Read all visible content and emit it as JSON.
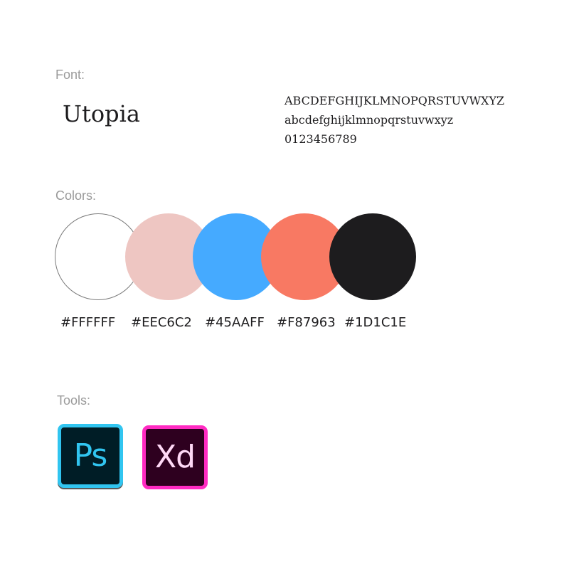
{
  "font_section": {
    "label": "Font:",
    "font_name": "Utopia",
    "uppercase": "ABCDEFGHIJKLMNOPQRSTUVWXYZ",
    "lowercase": "abcdefghijklmnopqrstuvwxyz",
    "digits": "0123456789"
  },
  "colors_section": {
    "label": "Colors:",
    "swatches": [
      {
        "hex": "#FFFFFF",
        "color": "#FFFFFF"
      },
      {
        "hex": "#EEC6C2",
        "color": "#EEC6C2"
      },
      {
        "hex": "#45AAFF",
        "color": "#45AAFF"
      },
      {
        "hex": "#F87963",
        "color": "#F87963"
      },
      {
        "hex": "#1D1C1E",
        "color": "#1D1C1E"
      }
    ]
  },
  "tools_section": {
    "label": "Tools:",
    "tools": [
      {
        "icon": "photoshop-icon",
        "text": "Ps",
        "bg": "#001D26",
        "accent": "#31C5F0"
      },
      {
        "icon": "xd-icon",
        "text": "Xd",
        "bg": "#2E001F",
        "accent": "#FF2BC2"
      }
    ]
  }
}
